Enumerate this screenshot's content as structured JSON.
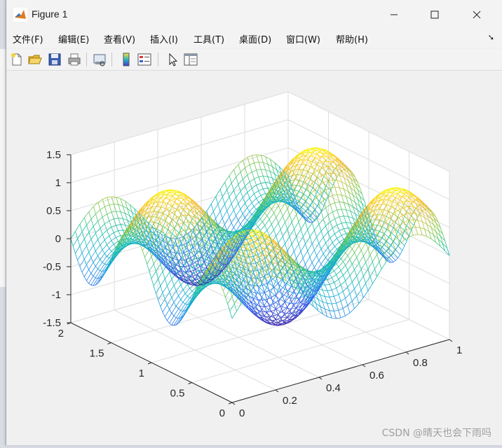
{
  "window": {
    "title": "Figure 1",
    "controls": [
      "minimize",
      "maximize",
      "close"
    ]
  },
  "menu": [
    {
      "label": "文件(F)"
    },
    {
      "label": "编辑(E)"
    },
    {
      "label": "查看(V)"
    },
    {
      "label": "插入(I)"
    },
    {
      "label": "工具(T)"
    },
    {
      "label": "桌面(D)"
    },
    {
      "label": "窗口(W)"
    },
    {
      "label": "帮助(H)"
    }
  ],
  "toolbar": [
    {
      "icon": "new-figure-icon"
    },
    {
      "icon": "open-file-icon"
    },
    {
      "icon": "save-icon"
    },
    {
      "icon": "print-icon"
    },
    {
      "icon": "link-plot-icon"
    },
    {
      "icon": "colorbar-icon"
    },
    {
      "icon": "legend-icon"
    },
    {
      "icon": "pointer-icon"
    },
    {
      "icon": "property-inspector-icon"
    }
  ],
  "watermark": "CSDN @晴天也会下雨吗",
  "chart_data": {
    "type": "mesh",
    "title": "",
    "xlabel": "",
    "ylabel": "",
    "zlabel": "",
    "function": "z = sin(2πx) + sin(2πy) − centered wave surface (two peaks and two valleys per axis period)",
    "xlim": [
      0,
      1
    ],
    "ylim": [
      0,
      2
    ],
    "zlim": [
      -1.5,
      1.5
    ],
    "x_ticks": [
      "0",
      "0.2",
      "0.4",
      "0.6",
      "0.8",
      "1"
    ],
    "y_ticks": [
      "0",
      "0.5",
      "1",
      "1.5",
      "2"
    ],
    "z_ticks": [
      "-1.5",
      "-1",
      "-0.5",
      "0",
      "0.5",
      "1",
      "1.5"
    ],
    "colormap": "parula",
    "grid": true
  }
}
